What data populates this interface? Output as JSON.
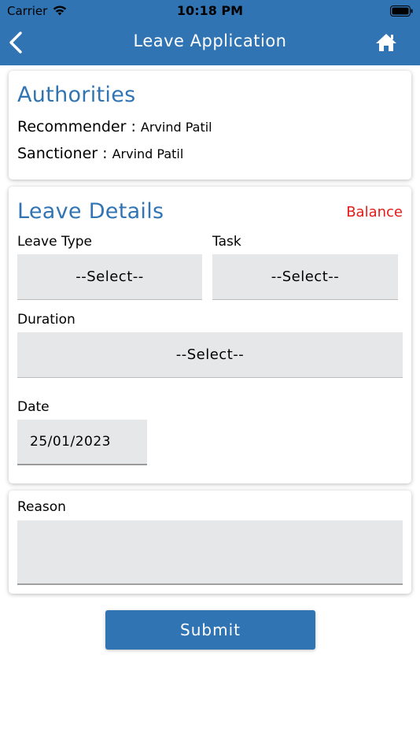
{
  "status_bar": {
    "carrier": "Carrier",
    "time": "10:18 PM",
    "wifi_icon": "wifi-icon",
    "battery_icon": "battery-icon"
  },
  "nav": {
    "title": "Leave Application",
    "back_icon": "chevron-left-icon",
    "home_icon": "home-icon"
  },
  "authorities": {
    "title": "Authorities",
    "recommender_label": "Recommender : ",
    "recommender_name": "Arvind Patil",
    "sanctioner_label": "Sanctioner : ",
    "sanctioner_name": "Arvind Patil"
  },
  "leave_details": {
    "title": "Leave Details",
    "balance_link": "Balance",
    "leave_type_label": "Leave Type",
    "leave_type_value": "--Select--",
    "task_label": "Task",
    "task_value": "--Select--",
    "duration_label": "Duration",
    "duration_value": "--Select--",
    "date_label": "Date",
    "date_value": "25/01/2023"
  },
  "reason": {
    "label": "Reason",
    "value": ""
  },
  "actions": {
    "submit_label": "Submit"
  },
  "colors": {
    "header_blue": "#3174b3",
    "balance_red": "#e41b17",
    "field_gray": "#e6e7e8"
  }
}
